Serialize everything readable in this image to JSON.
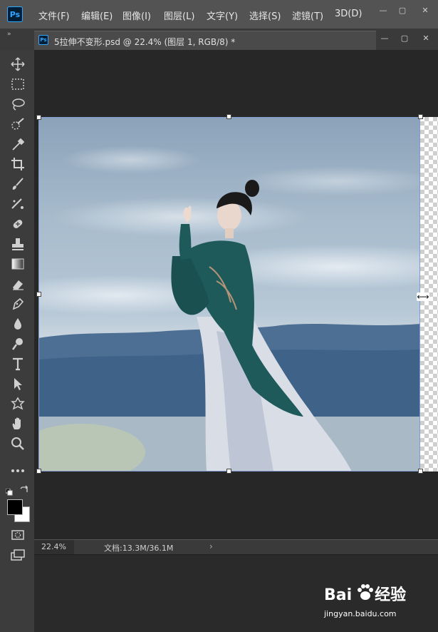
{
  "app": {
    "logo_text": "Ps"
  },
  "menu": {
    "items": [
      "文件(F)",
      "编辑(E)",
      "图像(I)",
      "图层(L)",
      "文字(Y)",
      "选择(S)",
      "滤镜(T)",
      "3D(D)"
    ]
  },
  "window_controls": {
    "minimize": "—",
    "maximize": "▢",
    "close": "✕"
  },
  "panel_toggle": "»",
  "document_tab": {
    "icon_text": "Ps",
    "title": "5拉伸不变形.psd @ 22.4% (图层 1, RGB/8) *"
  },
  "status_bar": {
    "zoom": "22.4%",
    "doc_info": "文档:13.3M/36.1M",
    "arrow": "›"
  },
  "tools": [
    "move-tool-icon",
    "marquee-tool-icon",
    "lasso-tool-icon",
    "quick-select-tool-icon",
    "eyedropper-tool-icon",
    "crop-tool-icon",
    "brush-tool-icon",
    "healing-tool-icon",
    "patch-tool-icon",
    "stamp-tool-icon",
    "gradient-tool-icon",
    "eraser-tool-icon",
    "pen-tool-icon",
    "blur-tool-icon",
    "dodge-tool-icon",
    "type-tool-icon",
    "path-select-tool-icon",
    "shape-tool-icon",
    "hand-tool-icon",
    "zoom-tool-icon",
    "more-tools-icon"
  ],
  "colors": {
    "foreground": "#000000",
    "background": "#ffffff",
    "selection_border": "#7f9bd1",
    "ui_dark": "#3c3c3c"
  },
  "watermark": {
    "brand_left": "Bai",
    "brand_right": "经验",
    "url": "jingyan.baidu.com"
  }
}
